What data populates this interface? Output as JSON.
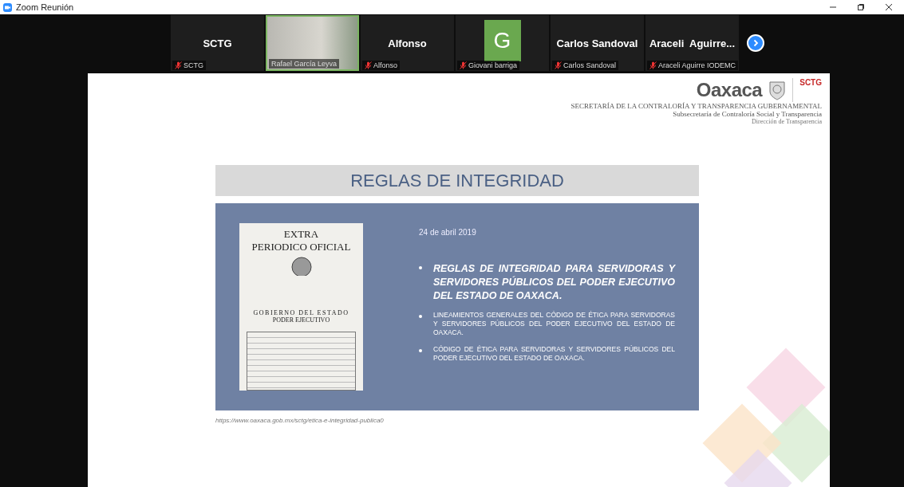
{
  "window": {
    "title": "Zoom Reunión"
  },
  "participants": [
    {
      "kind": "name",
      "display": "SCTG",
      "label": "SCTG",
      "muted": true,
      "speaking": false
    },
    {
      "kind": "video",
      "label": "Rafael García Leyva",
      "muted": false,
      "speaking": true
    },
    {
      "kind": "name",
      "display": "Alfonso",
      "label": "Alfonso",
      "muted": true,
      "speaking": false
    },
    {
      "kind": "avatar",
      "display": "G",
      "label": "Giovani barriga",
      "muted": true,
      "speaking": false
    },
    {
      "kind": "name",
      "display": "Carlos Sandoval",
      "label": "Carlos Sandoval",
      "muted": true,
      "speaking": false
    },
    {
      "kind": "name",
      "display": "Araceli  Aguirre...",
      "label": "Araceli Aguirre IODEMC",
      "muted": true,
      "speaking": false
    }
  ],
  "slide": {
    "logo": {
      "name": "Oaxaca",
      "badge": "SCTG"
    },
    "header_lines": [
      "SECRETARÍA DE LA CONTRALORÍA Y TRANSPARENCIA GUBERNAMENTAL",
      "Subsecretaría de Contraloría Social y Transparencia",
      "Dirección de Transparencia"
    ],
    "title": "REGLAS DE INTEGRIDAD",
    "document": {
      "lines": [
        "EXTRA",
        "PERIODICO OFICIAL",
        "GOBIERNO DEL ESTADO",
        "PODER EJECUTIVO"
      ]
    },
    "date": "24 de abril 2019",
    "bullets": [
      {
        "kind": "main",
        "text": "REGLAS DE INTEGRIDAD PARA SERVIDORAS Y SERVIDORES PÚBLICOS DEL PODER EJECUTIVO DEL ESTADO DE OAXACA."
      },
      {
        "kind": "sub",
        "text": "LINEAMIENTOS GENERALES DEL CÓDIGO DE ÉTICA PARA SERVIDORAS Y SERVIDORES PÚBLICOS DEL PODER EJECUTIVO DEL ESTADO DE OAXACA."
      },
      {
        "kind": "sub",
        "text": "CÓDIGO DE ÉTICA PARA SERVIDORAS Y SERVIDORES PÚBLICOS DEL PODER EJECUTIVO DEL ESTADO DE OAXACA."
      }
    ],
    "url": "https://www.oaxaca.gob.mx/sctg/etica-e-integridad-publica0"
  }
}
